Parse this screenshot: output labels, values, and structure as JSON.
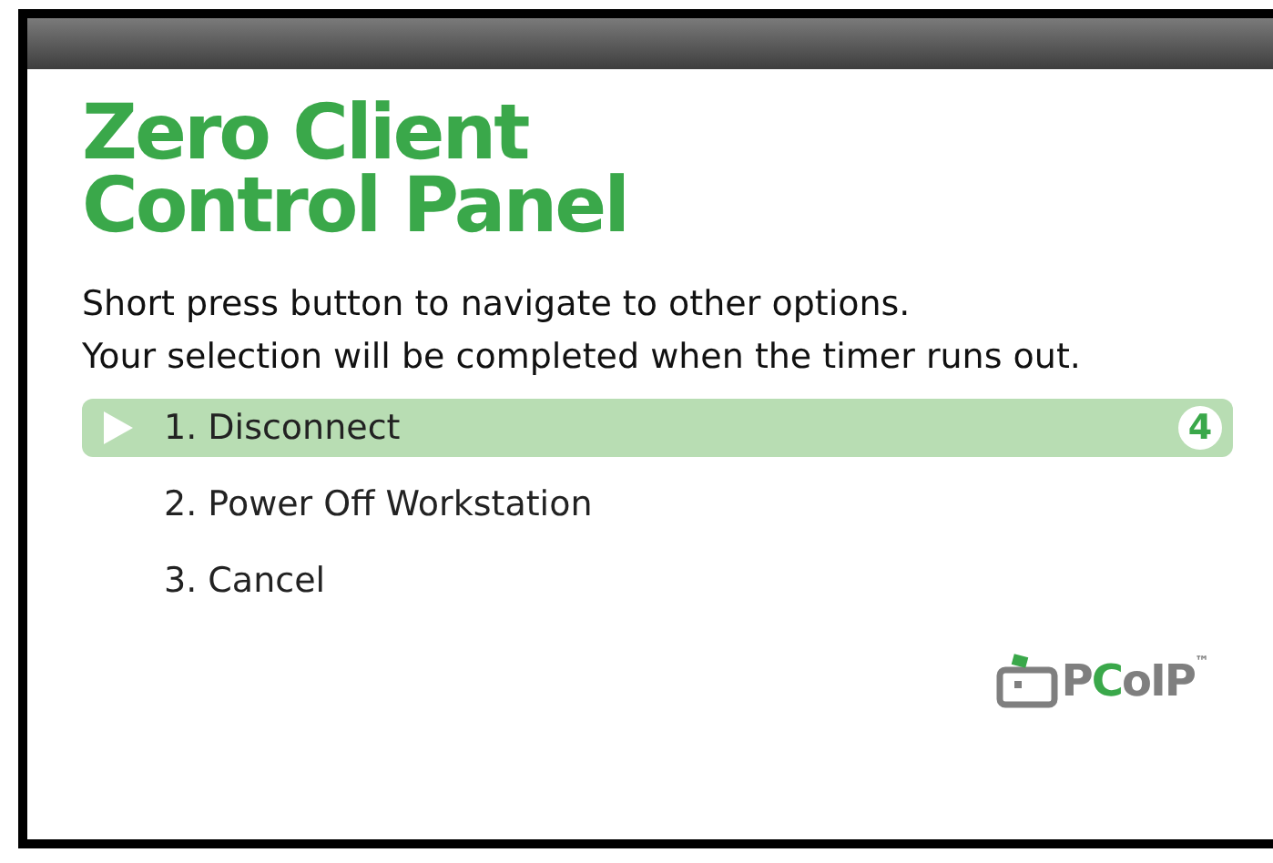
{
  "title_lines": [
    "Zero Client",
    "Control Panel"
  ],
  "instructions": [
    "Short press button to navigate to other options.",
    "Your selection will be completed when the timer runs out."
  ],
  "options": [
    {
      "label": "1. Disconnect",
      "selected": true,
      "timer": "4"
    },
    {
      "label": "2. Power Off Workstation",
      "selected": false
    },
    {
      "label": "3. Cancel",
      "selected": false
    }
  ],
  "logo": {
    "segments": [
      {
        "text": "P",
        "color": "#7f7f7f"
      },
      {
        "text": "C",
        "color": "#3aa84a"
      },
      {
        "text": "oIP",
        "color": "#7f7f7f"
      }
    ],
    "trademark": "™"
  }
}
